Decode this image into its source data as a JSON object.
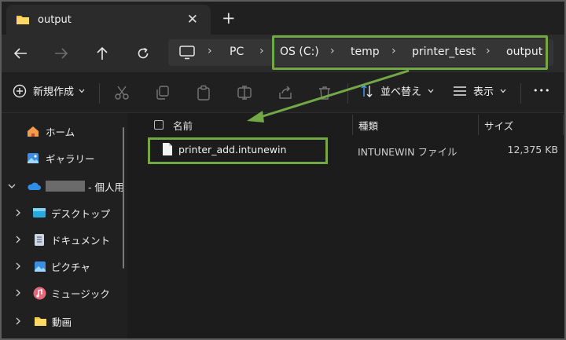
{
  "tab": {
    "title": "output",
    "close_glyph": "✕",
    "new_tab_glyph": "+"
  },
  "nav": {
    "back": "back-arrow-icon",
    "forward": "forward-arrow-icon",
    "up": "up-arrow-icon",
    "refresh": "refresh-icon"
  },
  "address": {
    "segments": [
      "PC",
      "OS (C:)",
      "temp",
      "printer_test",
      "output"
    ],
    "separator": "›"
  },
  "toolbar": {
    "new_label": "新規作成",
    "sort_label": "並べ替え",
    "view_label": "表示",
    "more_label": "•••"
  },
  "sidebar": {
    "items": [
      {
        "label": "ホーム"
      },
      {
        "label": "ギャラリー"
      },
      {
        "label": "- 個人用"
      },
      {
        "label": "デスクトップ"
      },
      {
        "label": "ドキュメント"
      },
      {
        "label": "ピクチャ"
      },
      {
        "label": "ミュージック"
      },
      {
        "label": "動画"
      }
    ]
  },
  "columns": {
    "name": "名前",
    "type": "種類",
    "size": "サイズ"
  },
  "files": [
    {
      "name": "printer_add.intunewin",
      "type": "INTUNEWIN ファイル",
      "size": "12,375 KB"
    }
  ],
  "colors": {
    "highlight": "#72a846",
    "accent": "#4aa3ff",
    "folder": "#f5c342"
  }
}
